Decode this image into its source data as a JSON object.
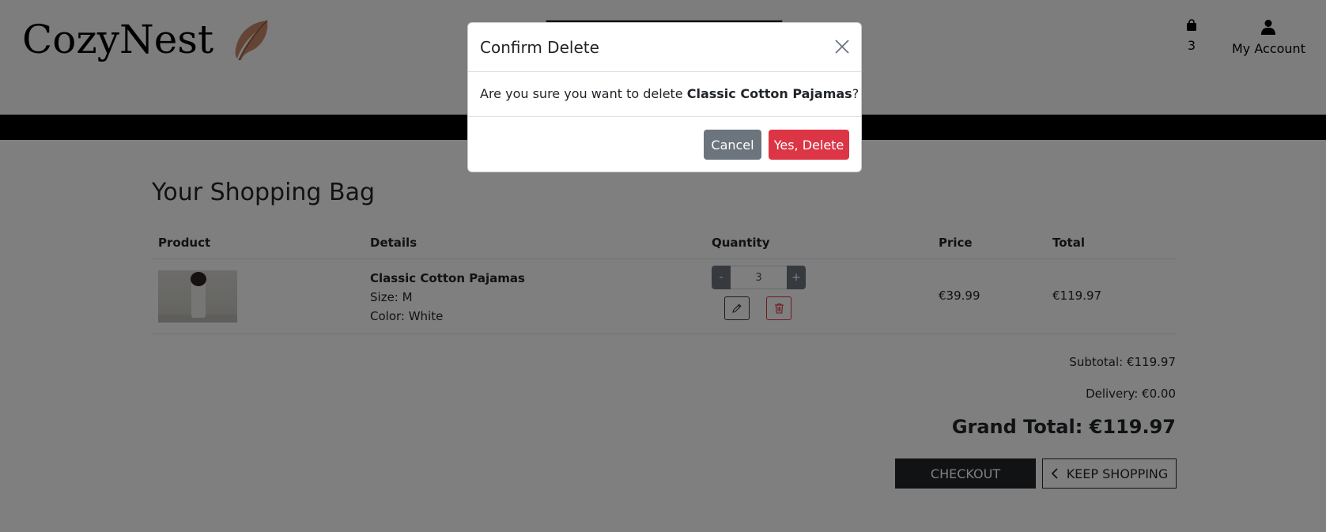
{
  "header": {
    "logo_text": "CozyNest",
    "bag_count": "3",
    "account_label": "My Account"
  },
  "page": {
    "title": "Your Shopping Bag"
  },
  "table": {
    "columns": [
      "Product",
      "Details",
      "Quantity",
      "Price",
      "Total"
    ],
    "rows": [
      {
        "name": "Classic Cotton Pajamas",
        "size": "Size: M",
        "color": "Color: White",
        "quantity": "3",
        "minus_label": "-",
        "plus_label": "+",
        "price": "€39.99",
        "total": "€119.97"
      }
    ]
  },
  "summary": {
    "subtotal": "Subtotal: €119.97",
    "delivery": "Delivery: €0.00",
    "grand_total": "Grand Total: €119.97"
  },
  "actions": {
    "checkout_label": "Checkout",
    "keep_shopping_label": "Keep Shopping"
  },
  "modal": {
    "title": "Confirm Delete",
    "body_prefix": "Are you sure you want to delete ",
    "body_item": "Classic Cotton Pajamas",
    "body_suffix": "?",
    "cancel_label": "Cancel",
    "confirm_label": "Yes, Delete"
  },
  "icons": {
    "logo": "feather-icon",
    "bag": "shopping-bag-icon",
    "account": "user-icon",
    "edit": "pencil-icon",
    "delete": "trash-icon",
    "back": "chevron-left-icon",
    "close": "close-icon"
  },
  "colors": {
    "danger": "#dc3545",
    "secondary": "#6c757d",
    "dark": "#212529"
  }
}
